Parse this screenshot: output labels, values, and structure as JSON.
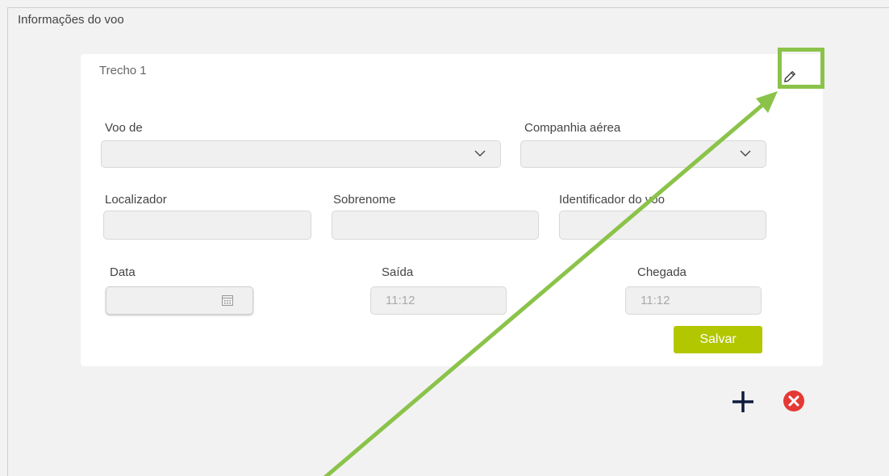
{
  "section": {
    "title": "Informações do voo"
  },
  "card": {
    "title": "Trecho 1",
    "fields": {
      "voo_de": {
        "label": "Voo de",
        "value": ""
      },
      "companhia": {
        "label": "Companhia aérea",
        "value": ""
      },
      "localizador": {
        "label": "Localizador",
        "value": ""
      },
      "sobrenome": {
        "label": "Sobrenome",
        "value": ""
      },
      "identificador": {
        "label": "Identificador do voo",
        "value": ""
      },
      "data": {
        "label": "Data",
        "value": ""
      },
      "saida": {
        "label": "Saída",
        "value": "11:12"
      },
      "chegada": {
        "label": "Chegada",
        "value": "11:12"
      }
    },
    "save_label": "Salvar"
  },
  "icons": {
    "edit": "pencil-icon",
    "add": "plus-icon",
    "remove": "close-circle-icon",
    "calendar": "calendar-icon",
    "dropdown": "chevron-down-icon"
  },
  "colors": {
    "accent": "#b2c700",
    "annotation": "#8bc34a",
    "remove": "#e53935",
    "add": "#0d1b3e"
  }
}
